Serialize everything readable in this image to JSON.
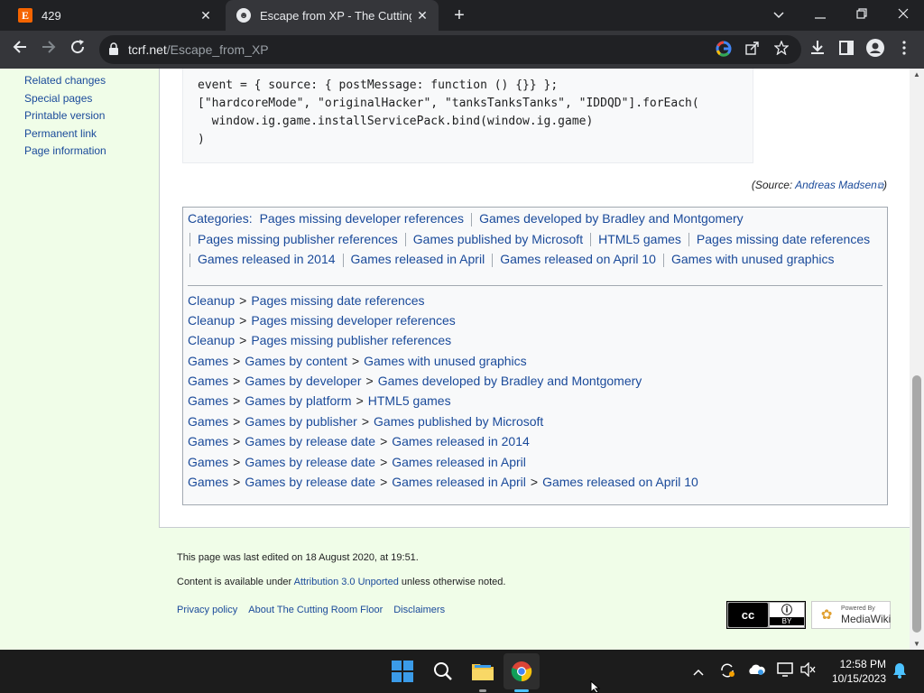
{
  "browser": {
    "tabs": [
      {
        "favicon": "E",
        "title": "429",
        "close": "✕"
      },
      {
        "favicon": "☻",
        "title": "Escape from XP - The Cutting Ro",
        "close": "✕"
      }
    ],
    "new_tab": "+",
    "url_host": "tcrf.net",
    "url_path": "/Escape_from_XP"
  },
  "sidebar": {
    "links": [
      "Related changes",
      "Special pages",
      "Printable version",
      "Permanent link",
      "Page information"
    ]
  },
  "code": {
    "lines": [
      "event = { source: { postMessage: function () {}} };",
      "[\"hardcoreMode\", \"originalHacker\", \"tanksTanksTanks\", \"IDDQD\"].forEach(",
      "  window.ig.game.installServicePack.bind(window.ig.game)",
      ")"
    ]
  },
  "source": {
    "prefix": "(Source: ",
    "author": "Andreas Madsen",
    "suffix": ")"
  },
  "categories": {
    "label": "Categories:",
    "items": [
      "Pages missing developer references",
      "Games developed by Bradley and Montgomery",
      "Pages missing publisher references",
      "Games published by Microsoft",
      "HTML5 games",
      "Pages missing date references",
      "Games released in 2014",
      "Games released in April",
      "Games released on April 10",
      "Games with unused graphics"
    ],
    "trees": [
      [
        "Cleanup",
        "Pages missing date references"
      ],
      [
        "Cleanup",
        "Pages missing developer references"
      ],
      [
        "Cleanup",
        "Pages missing publisher references"
      ],
      [
        "Games",
        "Games by content",
        "Games with unused graphics"
      ],
      [
        "Games",
        "Games by developer",
        "Games developed by Bradley and Montgomery"
      ],
      [
        "Games",
        "Games by platform",
        "HTML5 games"
      ],
      [
        "Games",
        "Games by publisher",
        "Games published by Microsoft"
      ],
      [
        "Games",
        "Games by release date",
        "Games released in 2014"
      ],
      [
        "Games",
        "Games by release date",
        "Games released in April"
      ],
      [
        "Games",
        "Games by release date",
        "Games released in April",
        "Games released on April 10"
      ]
    ]
  },
  "footer": {
    "last_edited": "This page was last edited on 18 August 2020, at 19:51.",
    "license_prefix": "Content is available under ",
    "license_link": "Attribution 3.0 Unported",
    "license_suffix": " unless otherwise noted.",
    "links": [
      "Privacy policy",
      "About The Cutting Room Floor",
      "Disclaimers"
    ],
    "cc_badge": {
      "cc": "cc",
      "i": "ⓘ",
      "by": "BY"
    },
    "mw_badge": {
      "small": "Powered By",
      "big": "MediaWiki"
    }
  },
  "taskbar": {
    "time": "12:58 PM",
    "date": "10/15/2023"
  },
  "colors": {
    "link": "#1a4a9a",
    "sidebar_bg": "#f0fde8",
    "chrome_dark": "#202124",
    "chrome_toolbar": "#35363a"
  }
}
